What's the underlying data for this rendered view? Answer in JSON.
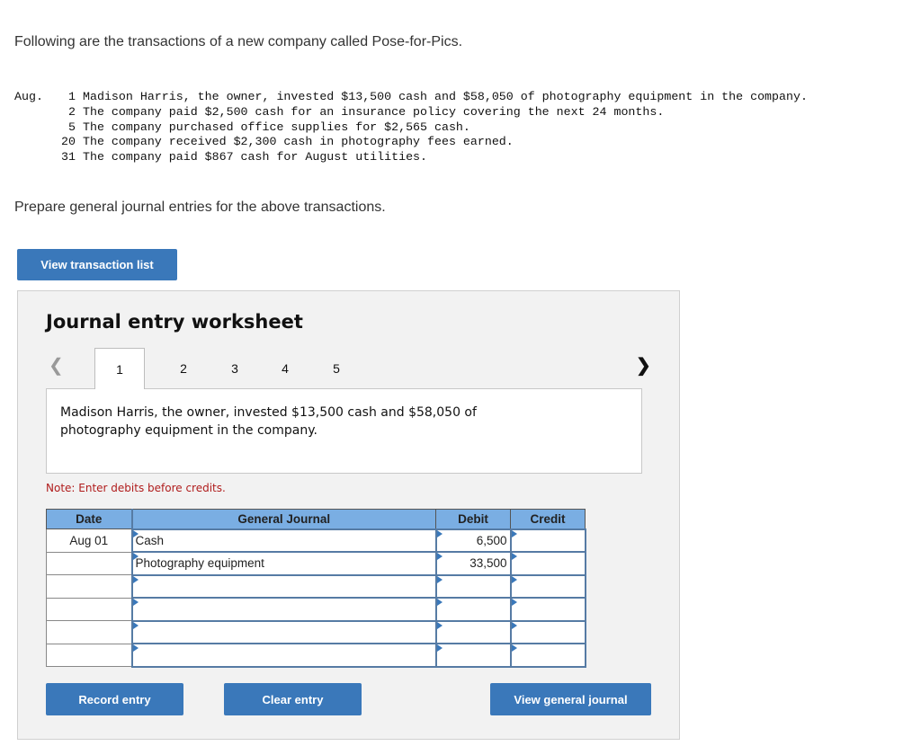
{
  "intro": "Following are the transactions of a new company called Pose-for-Pics.",
  "transactions": {
    "month": "Aug.",
    "items": [
      {
        "day": "1",
        "text": "Madison Harris, the owner, invested $13,500 cash and $58,050 of photography equipment in the company."
      },
      {
        "day": "2",
        "text": "The company paid $2,500 cash for an insurance policy covering the next 24 months."
      },
      {
        "day": "5",
        "text": "The company purchased office supplies for $2,565 cash."
      },
      {
        "day": "20",
        "text": "The company received $2,300 cash in photography fees earned."
      },
      {
        "day": "31",
        "text": "The company paid $867 cash for August utilities."
      }
    ]
  },
  "prompt": "Prepare general journal entries for the above transactions.",
  "buttons": {
    "view_transaction_list": "View transaction list",
    "record_entry": "Record entry",
    "clear_entry": "Clear entry",
    "view_general_journal": "View general journal"
  },
  "worksheet": {
    "title": "Journal entry worksheet",
    "prev_icon": "chevron-left-icon",
    "next_icon": "chevron-right-icon",
    "tabs": [
      "1",
      "2",
      "3",
      "4",
      "5"
    ],
    "active_tab": "1",
    "description": "Madison Harris, the owner, invested $13,500 cash and $58,050 of photography equipment in the company.",
    "note": "Note: Enter debits before credits."
  },
  "journal": {
    "headers": {
      "date": "Date",
      "account": "General Journal",
      "debit": "Debit",
      "credit": "Credit"
    },
    "rows": [
      {
        "date": "Aug 01",
        "account": "Cash",
        "debit": "6,500",
        "credit": ""
      },
      {
        "date": "",
        "account": "Photography equipment",
        "debit": "33,500",
        "credit": ""
      },
      {
        "date": "",
        "account": "",
        "debit": "",
        "credit": ""
      },
      {
        "date": "",
        "account": "",
        "debit": "",
        "credit": ""
      },
      {
        "date": "",
        "account": "",
        "debit": "",
        "credit": ""
      },
      {
        "date": "",
        "account": "",
        "debit": "",
        "credit": ""
      }
    ]
  },
  "colors": {
    "button": "#3a78ba",
    "header": "#7aaee3",
    "note": "#b01c1c"
  }
}
